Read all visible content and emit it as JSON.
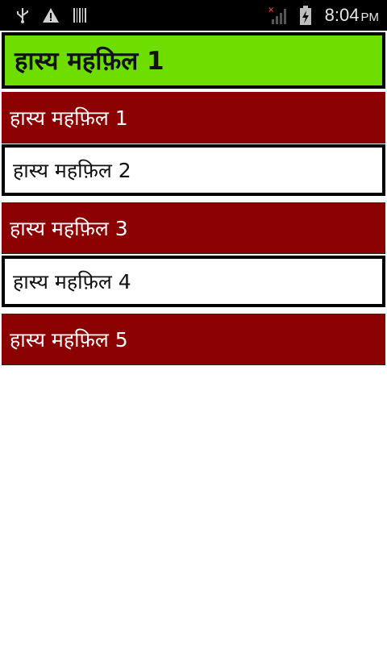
{
  "status_bar": {
    "time": "8:04",
    "ampm": "PM",
    "icons": [
      "usb-icon",
      "warning-icon",
      "barcode-icon",
      "no-signal-icon",
      "battery-charging-icon"
    ]
  },
  "title": "हास्य महफ़िल 1",
  "items": [
    {
      "label": "हास्य महफ़िल 1"
    },
    {
      "label": "हास्य महफ़िल 2"
    },
    {
      "label": "हास्य महफ़िल 3"
    },
    {
      "label": "हास्य महफ़िल 4"
    },
    {
      "label": "हास्य महफ़िल 5"
    }
  ],
  "colors": {
    "title_bg": "#6edd00",
    "dark_row_bg": "#8b0000",
    "light_row_bg": "#ffffff"
  }
}
